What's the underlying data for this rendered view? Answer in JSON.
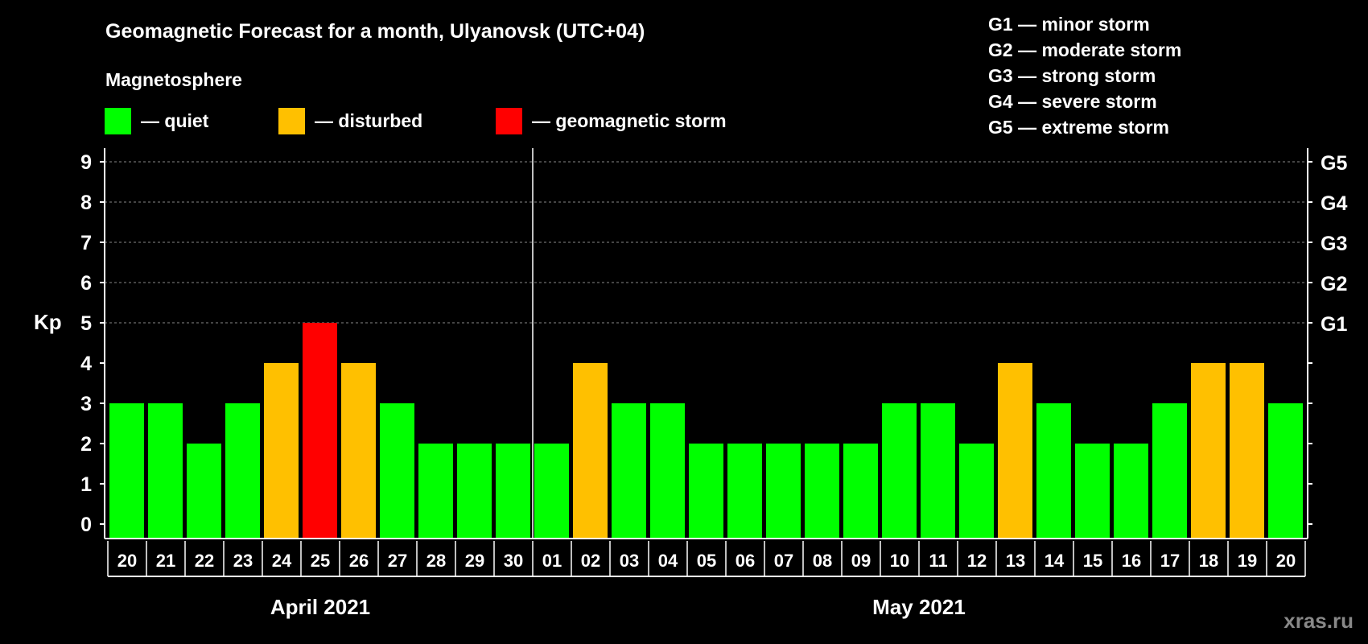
{
  "chart_data": {
    "type": "bar",
    "title": "Geomagnetic Forecast for a month, Ulyanovsk (UTC+04)",
    "subtitle": "Magnetosphere",
    "ylabel": "Kp",
    "ylim": [
      0,
      9
    ],
    "yticks": [
      "0",
      "1",
      "2",
      "3",
      "4",
      "5",
      "6",
      "7",
      "8",
      "9"
    ],
    "right_ticks": [
      {
        "kp": 5,
        "label": "G1"
      },
      {
        "kp": 6,
        "label": "G2"
      },
      {
        "kp": 7,
        "label": "G3"
      },
      {
        "kp": 8,
        "label": "G4"
      },
      {
        "kp": 9,
        "label": "G5"
      }
    ],
    "grid": "dashed horizontal at 5-9",
    "categories": [
      "20",
      "21",
      "22",
      "23",
      "24",
      "25",
      "26",
      "27",
      "28",
      "29",
      "30",
      "01",
      "02",
      "03",
      "04",
      "05",
      "06",
      "07",
      "08",
      "09",
      "10",
      "11",
      "12",
      "13",
      "14",
      "15",
      "16",
      "17",
      "18",
      "19",
      "20"
    ],
    "values": [
      3,
      3,
      2,
      3,
      4,
      5,
      4,
      3,
      2,
      2,
      2,
      2,
      4,
      3,
      3,
      2,
      2,
      2,
      2,
      2,
      3,
      3,
      2,
      4,
      3,
      2,
      2,
      3,
      4,
      4,
      3
    ],
    "months": [
      {
        "label": "April 2021",
        "start": 0,
        "count": 11
      },
      {
        "label": "May 2021",
        "start": 11,
        "count": 20
      }
    ],
    "legend": [
      {
        "label": "— quiet",
        "color": "#00ff00"
      },
      {
        "label": "— disturbed",
        "color": "#ffc000"
      },
      {
        "label": "— geomagnetic storm",
        "color": "#ff0000"
      }
    ],
    "storm_scale": [
      "G1 — minor storm",
      "G2 — moderate storm",
      "G3 — strong storm",
      "G4 — severe storm",
      "G5 — extreme storm"
    ]
  },
  "watermark": "xras.ru"
}
